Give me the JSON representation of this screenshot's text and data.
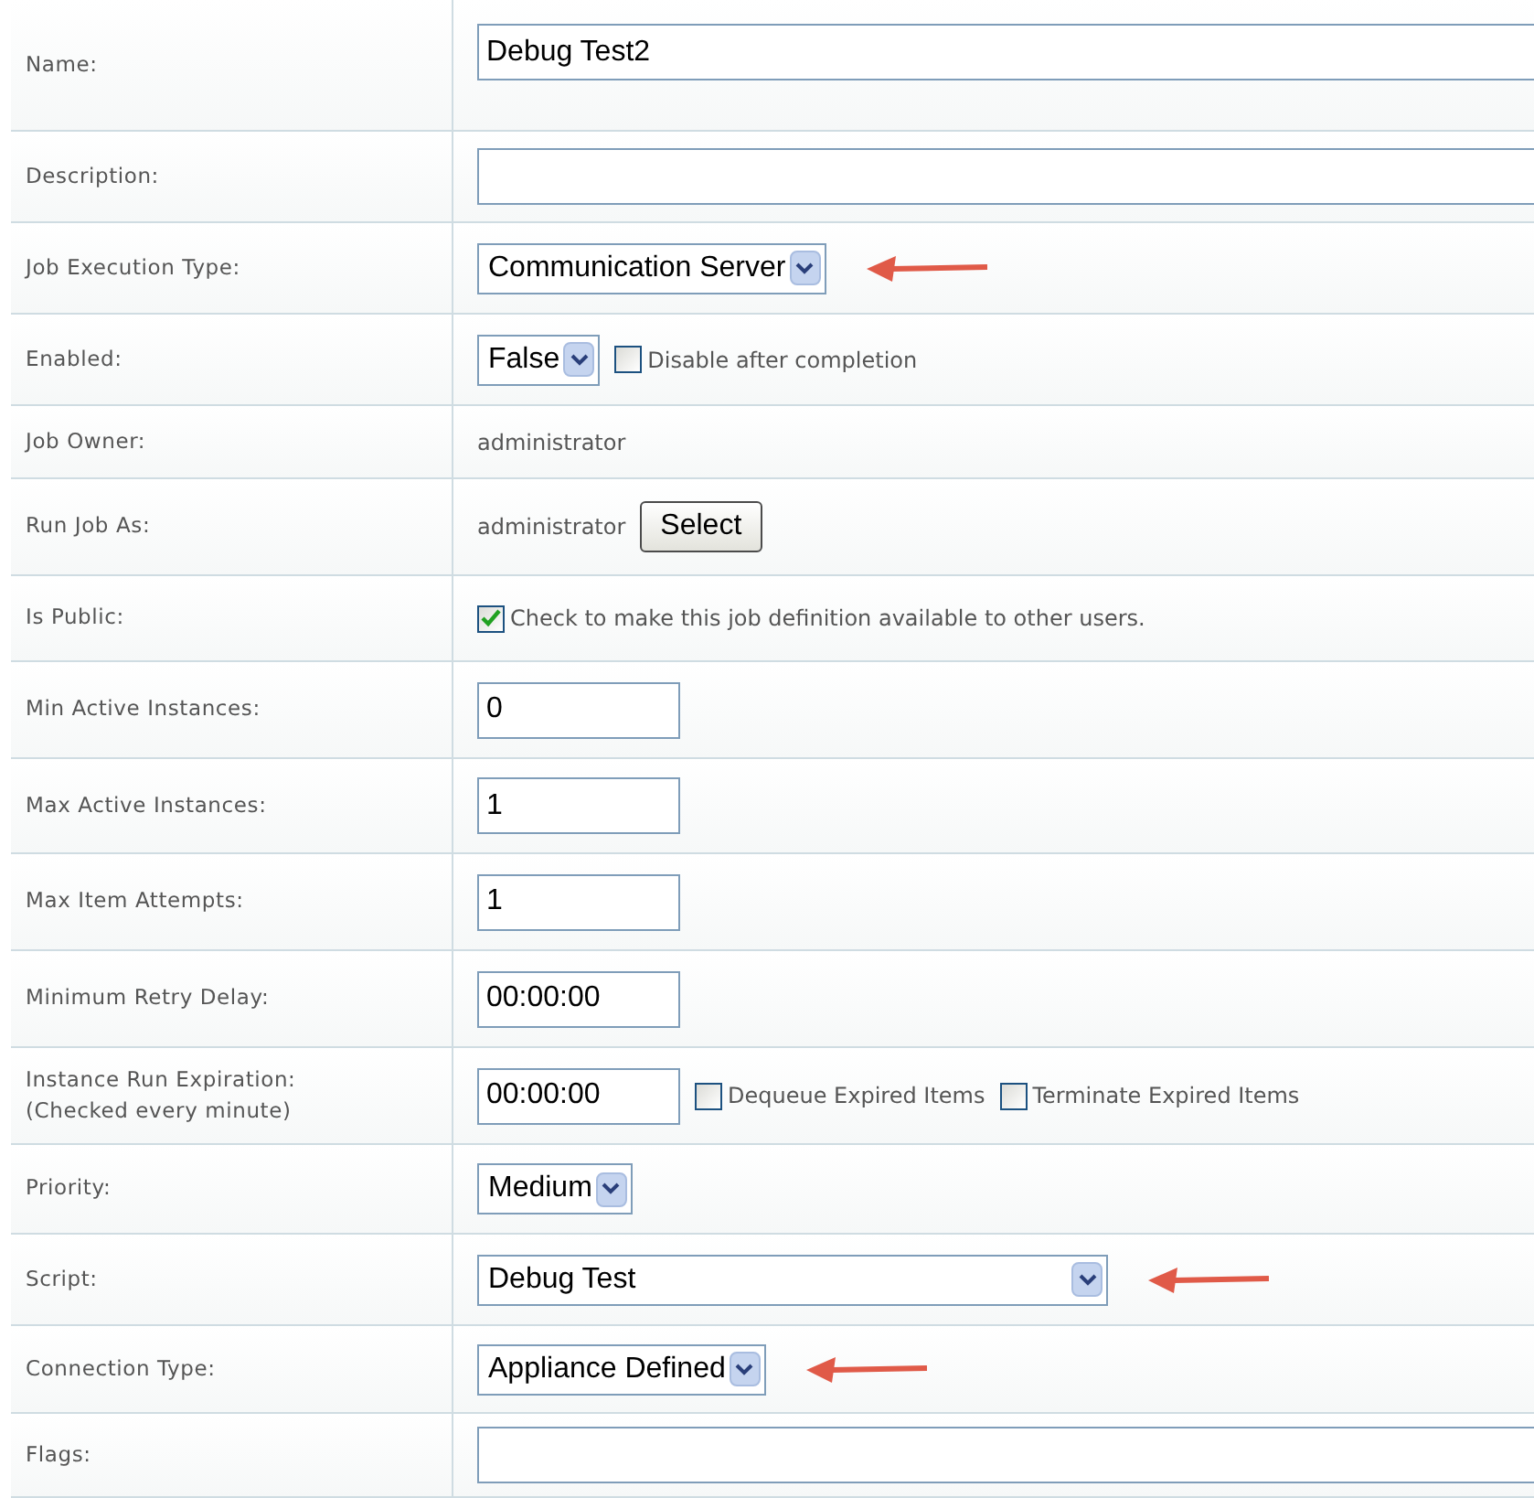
{
  "rows": [
    {
      "label": "Name:",
      "arrow": false,
      "controls": [
        {
          "kind": "wide-input",
          "value": "Debug Test2"
        }
      ]
    },
    {
      "label": "Description:",
      "arrow": false,
      "controls": [
        {
          "kind": "wide-input"
        }
      ]
    },
    {
      "label": "Job Execution Type:",
      "arrow": true,
      "controls": [
        {
          "kind": "select",
          "value": "Communication Server"
        }
      ]
    },
    {
      "label": "Enabled:",
      "arrow": false,
      "controls": [
        {
          "kind": "select",
          "value": "False"
        },
        {
          "kind": "checkbox",
          "checked": false,
          "label": "Disable after completion"
        }
      ]
    },
    {
      "label": "Job Owner:",
      "arrow": false,
      "controls": [
        {
          "kind": "text",
          "value": "administrator"
        }
      ]
    },
    {
      "label": "Run Job As:",
      "arrow": false,
      "controls": [
        {
          "kind": "text",
          "value": "administrator"
        },
        {
          "kind": "button",
          "value": "Select"
        }
      ]
    },
    {
      "label": "Is Public:",
      "arrow": false,
      "controls": [
        {
          "kind": "checkbox",
          "checked": true,
          "label": "Check to make this job definition available to other users."
        }
      ]
    },
    {
      "label": "Min Active Instances:",
      "arrow": false,
      "controls": [
        {
          "kind": "input",
          "value": "0"
        }
      ]
    },
    {
      "label": "Max Active Instances:",
      "arrow": false,
      "controls": [
        {
          "kind": "input",
          "value": "1"
        }
      ]
    },
    {
      "label": "Max Item Attempts:",
      "arrow": false,
      "controls": [
        {
          "kind": "input",
          "value": "1"
        }
      ]
    },
    {
      "label": "Minimum Retry Delay:",
      "arrow": false,
      "controls": [
        {
          "kind": "input",
          "value": "00:00:00"
        }
      ]
    },
    {
      "label": "Instance Run Expiration:",
      "note": "(Checked every minute)",
      "arrow": false,
      "controls": [
        {
          "kind": "input",
          "value": "00:00:00"
        },
        {
          "kind": "checkbox",
          "checked": false,
          "label": "Dequeue Expired Items"
        },
        {
          "kind": "checkbox",
          "checked": false,
          "label": "Terminate Expired Items"
        }
      ]
    },
    {
      "label": "Priority:",
      "arrow": false,
      "controls": [
        {
          "kind": "select",
          "value": "Medium"
        }
      ]
    },
    {
      "label": "Script:",
      "arrow": true,
      "controls": [
        {
          "kind": "wide-select",
          "value": "Debug Test"
        }
      ]
    },
    {
      "label": "Connection Type:",
      "arrow": true,
      "controls": [
        {
          "kind": "select",
          "value": "Appliance Defined"
        }
      ]
    },
    {
      "label": "Flags:",
      "arrow": false,
      "controls": [
        {
          "kind": "wide-input"
        }
      ]
    }
  ]
}
